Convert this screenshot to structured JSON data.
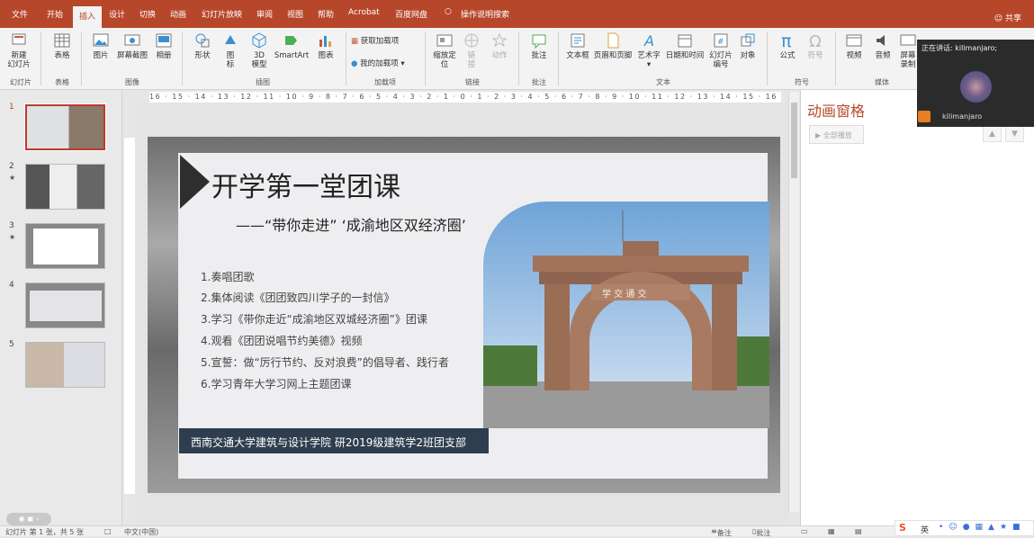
{
  "tabs": [
    "文件",
    "开始",
    "插入",
    "设计",
    "切换",
    "动画",
    "幻灯片放映",
    "审阅",
    "视图",
    "帮助",
    "Acrobat",
    "百度网盘",
    "操作说明搜索"
  ],
  "share": "共享",
  "ribbon": {
    "buttons": [
      "新建\n幻灯片",
      "表格",
      "图片",
      "屏幕截图",
      "相册",
      "形状",
      "图\n标",
      "3D\n模型",
      "SmartArt",
      "图表",
      "获取加载项",
      "我的加载项",
      "缩放定\n位",
      "链\n接",
      "动作",
      "批注",
      "文本框",
      "页眉和页脚",
      "艺术字",
      "日期和时间",
      "幻灯片\n编号",
      "对象",
      "公式",
      "符号",
      "视频",
      "音频",
      "屏幕\n录制"
    ],
    "groups": [
      "幻灯片",
      "表格",
      "图像",
      "插图",
      "加载项",
      "链接",
      "批注",
      "文本",
      "符号",
      "媒体"
    ]
  },
  "ruler_h": "16 · 15 · 14 · 13 · 12 · 11 · 10 · 9 · 8 · 7 · 6 · 5 · 4 · 3 · 2 · 1 · 0 · 1 · 2 · 3 · 4 · 5 · 6 · 7 · 8 · 9 · 10 · 11 · 12 · 13 · 14 · 15 · 16",
  "thumbnails": [
    {
      "num": "1",
      "star": ""
    },
    {
      "num": "2",
      "star": "★"
    },
    {
      "num": "3",
      "star": "★"
    },
    {
      "num": "4",
      "star": ""
    },
    {
      "num": "5",
      "star": ""
    }
  ],
  "slide": {
    "title": "开学第一堂团课",
    "subtitle": "——“带你走进” ‘成渝地区双经济圈’",
    "items": [
      "1.奏唱团歌",
      "2.集体阅读《团团致四川学子的一封信》",
      "3.学习《带你走近“成渝地区双城经济圈”》团课",
      "4.观看《团团说唱节约美德》视频",
      "5.宣誓：做“厉行节约、反对浪费”的倡导者、践行者",
      "6.学习青年大学习网上主题团课"
    ],
    "footer": "西南交通大学建筑与设计学院 研2019级建筑学2班团支部",
    "gate_text": "学 交 通 交"
  },
  "animation_pane": {
    "title": "动画窗格",
    "play_all": "全部播放"
  },
  "meeting": {
    "speaking": "正在讲话: kilimanjaro;",
    "name": "kilimanjaro"
  },
  "status": {
    "slide": "幻灯片 第 1 张，共 5 张",
    "lang": "中文(中国)",
    "notes": "备注",
    "comments": "批注"
  },
  "ime": {
    "lang": "英"
  },
  "colors": {
    "accent": "#b7472a",
    "footer_bg": "#2e3e4f"
  }
}
